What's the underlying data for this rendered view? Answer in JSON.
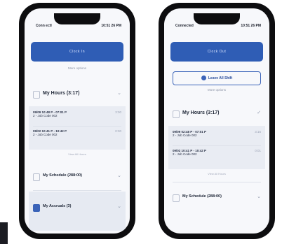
{
  "left_phone": {
    "status": {
      "carrier": "Conn ectl",
      "time": "10:51 26 PM"
    },
    "primary_button": "Clock In",
    "link": "More options",
    "hours_title": "My Hours (3:17)",
    "entries": [
      {
        "time": "09/09 10:48 P - 07:01 P",
        "job": "2 - Job Code 002",
        "amount": "3:00"
      },
      {
        "time": "09/02 10:41 P - 10:42 P",
        "job": "2 - Job Code 002",
        "amount": "0:00"
      }
    ],
    "view_more": "View All Hours",
    "schedule_title": "My Schedule (288:00)",
    "accruals_title": "My Accruals (3)"
  },
  "right_phone": {
    "status": {
      "carrier": "Connected",
      "time": "10:51 26 PM"
    },
    "primary_button": "Clock Out",
    "secondary_button": "Leave All Shift",
    "link": "More options",
    "hours_title": "My Hours (3:17)",
    "entries": [
      {
        "time": "09/09 02:48 P - 07:01 P",
        "job": "2 - Job Code 002",
        "amount": "3:16"
      },
      {
        "time": "09/02 10:41 P - 10:42 P",
        "job": "2 - Job Code 002",
        "amount": "0:01"
      }
    ],
    "view_more": "View All Hours",
    "schedule_title": "My Schedule (288:00)"
  },
  "colors": {
    "accent": "#2f5db5",
    "phone_frame": "#0d0d0f",
    "screen_bg": "#f7f8fb"
  }
}
